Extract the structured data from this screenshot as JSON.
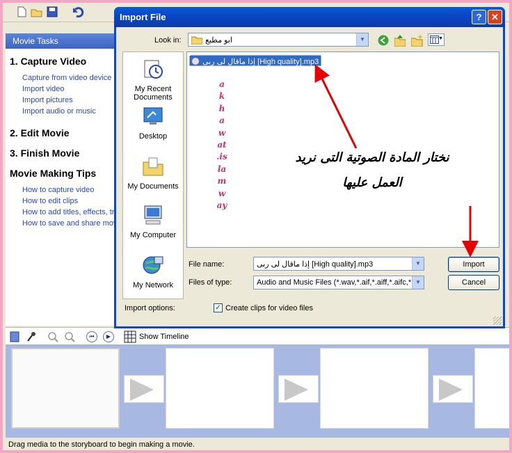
{
  "task_pane": {
    "header": "Movie Tasks",
    "sections": [
      {
        "title": "1. Capture Video",
        "links": [
          "Capture from video device",
          "Import video",
          "Import pictures",
          "Import audio or music"
        ]
      },
      {
        "title": "2. Edit Movie",
        "links": []
      },
      {
        "title": "3. Finish Movie",
        "links": []
      },
      {
        "title": "Movie Making Tips",
        "links": [
          "How to capture video",
          "How to edit clips",
          "How to add titles, effects, tr",
          "How to save and share movi"
        ]
      }
    ]
  },
  "storyboard": {
    "show_timeline_label": "Show Timeline",
    "status_text": "Drag media to the storyboard to begin making a movie."
  },
  "dialog": {
    "title": "Import File",
    "help_glyph": "?",
    "close_glyph": "✕",
    "look_in_label": "Look in:",
    "look_in_value": "ابو مطيع",
    "places": [
      "My Recent Documents",
      "Desktop",
      "My Documents",
      "My Computer",
      "My Network"
    ],
    "selected_file": "إذا ماقال لى ربى [High quality].mp3",
    "vertical_text": "akhawat.islamway",
    "annotation_line1": "نختار المادة الصوتية التى نريد",
    "annotation_line2": "العمل عليها",
    "file_name_label": "File name:",
    "file_name_value": "إذا ماقال لى ربى [High quality].mp3",
    "files_of_type_label": "Files of type:",
    "files_of_type_value": "Audio and Music Files (*.wav,*.aif,*.aiff,*.aifc,*.s",
    "import_button": "Import",
    "cancel_button": "Cancel",
    "import_options_label": "Import options:",
    "create_clips_label": "Create clips for video files",
    "create_clips_checked": true
  },
  "colors": {
    "annotation_arrow": "#e80000",
    "title_bar": "#0a46d8",
    "selection": "#316ac5"
  }
}
